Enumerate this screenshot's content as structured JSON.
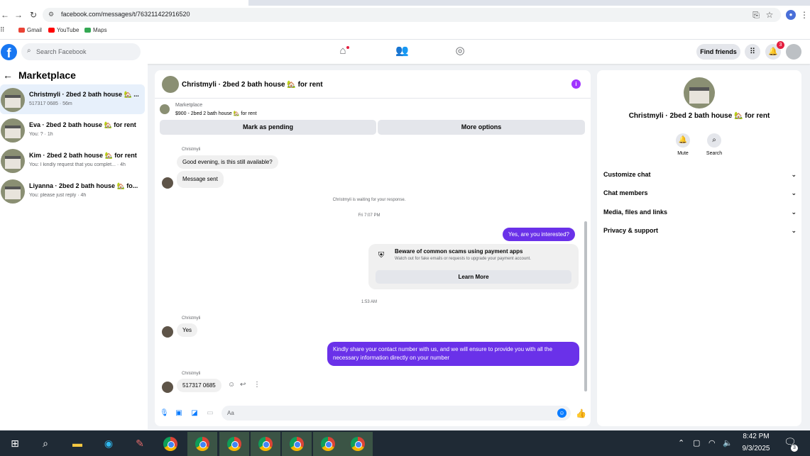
{
  "browser": {
    "url": "facebook.com/messages/t/763211422916520",
    "bookmarks": [
      {
        "label": "Gmail",
        "color": "#ea4335"
      },
      {
        "label": "YouTube",
        "color": "#ff0000"
      },
      {
        "label": "Maps",
        "color": "#34a853"
      }
    ]
  },
  "header": {
    "search_placeholder": "Search Facebook",
    "find_friends": "Find friends",
    "notification_count": "3"
  },
  "sidebar": {
    "title": "Marketplace",
    "conversations": [
      {
        "name": "Christmyli · 2bed 2 bath house 🏡 ...",
        "sub": "517317 0685 · 56m",
        "active": true
      },
      {
        "name": "Eva · 2bed 2 bath house 🏡 for rent",
        "sub": "You: ? · 1h",
        "active": false
      },
      {
        "name": "Kim · 2bed 2 bath house 🏡 for rent",
        "sub": "You: I kindly request that you complet... · 4h",
        "active": false
      },
      {
        "name": "Liyanna · 2bed 2 bath house 🏡 fo...",
        "sub": "You: please just reply · 4h",
        "active": false
      }
    ]
  },
  "chat": {
    "title": "Christmyli · 2bed 2 bath house 🏡 for rent",
    "marketplace_label": "Marketplace",
    "listing": "$900 - 2bed 2 bath house 🏡 for rent",
    "mark_pending": "Mark as pending",
    "more_options": "More options",
    "sender_name": "Christmyli",
    "msg1": "Good evening, is this still available?",
    "msg2": "Message sent",
    "waiting": "Christmyli is waiting for your response.",
    "time1": "Fri 7:07 PM",
    "out1": "Yes, are you interested?",
    "scam_title": "Beware of common scams using payment apps",
    "scam_body": "Watch out for fake emails or requests to upgrade your payment account.",
    "learn_more": "Learn More",
    "time2": "1:53 AM",
    "msg3": "Yes",
    "out2": "Kindly share your contact number with us, and we will ensure to provide you with all the necessary information directly on your number",
    "msg4": "517317 0685",
    "input_placeholder": "Aa",
    "accent": "#6a31e9"
  },
  "details": {
    "title": "Christmyli · 2bed 2 bath house 🏡 for rent",
    "mute": "Mute",
    "search": "Search",
    "rows": [
      "Customize chat",
      "Chat members",
      "Media, files and links",
      "Privacy & support"
    ]
  },
  "taskbar": {
    "time": "8:42 PM",
    "date": "9/3/2025",
    "action_center_count": "3"
  }
}
